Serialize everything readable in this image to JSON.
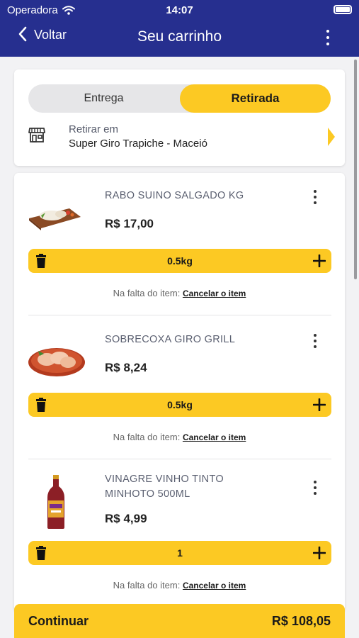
{
  "status_bar": {
    "carrier": "Operadora",
    "time": "14:07"
  },
  "nav": {
    "back_label": "Voltar",
    "title": "Seu carrinho"
  },
  "delivery": {
    "options": [
      "Entrega",
      "Retirada"
    ],
    "selected": "Retirada",
    "pickup_label": "Retirar em",
    "pickup_store": "Super Giro Trapiche - Maceió"
  },
  "cart": {
    "items": [
      {
        "name": "RABO SUINO SALGADO KG",
        "price": "R$ 17,00",
        "quantity": "0.5kg",
        "missing_label": "Na falta do item:",
        "missing_action": "Cancelar o item"
      },
      {
        "name": "SOBRECOXA GIRO GRILL",
        "price": "R$ 8,24",
        "quantity": "0.5kg",
        "missing_label": "Na falta do item:",
        "missing_action": "Cancelar o item"
      },
      {
        "name": "VINAGRE VINHO TINTO MINHOTO 500ML",
        "price": "R$ 4,99",
        "quantity": "1",
        "missing_label": "Na falta do item:",
        "missing_action": "Cancelar o item"
      }
    ]
  },
  "checkout": {
    "label": "Continuar",
    "total": "R$ 108,05"
  },
  "colors": {
    "header": "#262f8f",
    "accent": "#fcc923",
    "background": "#f2f2f4"
  }
}
